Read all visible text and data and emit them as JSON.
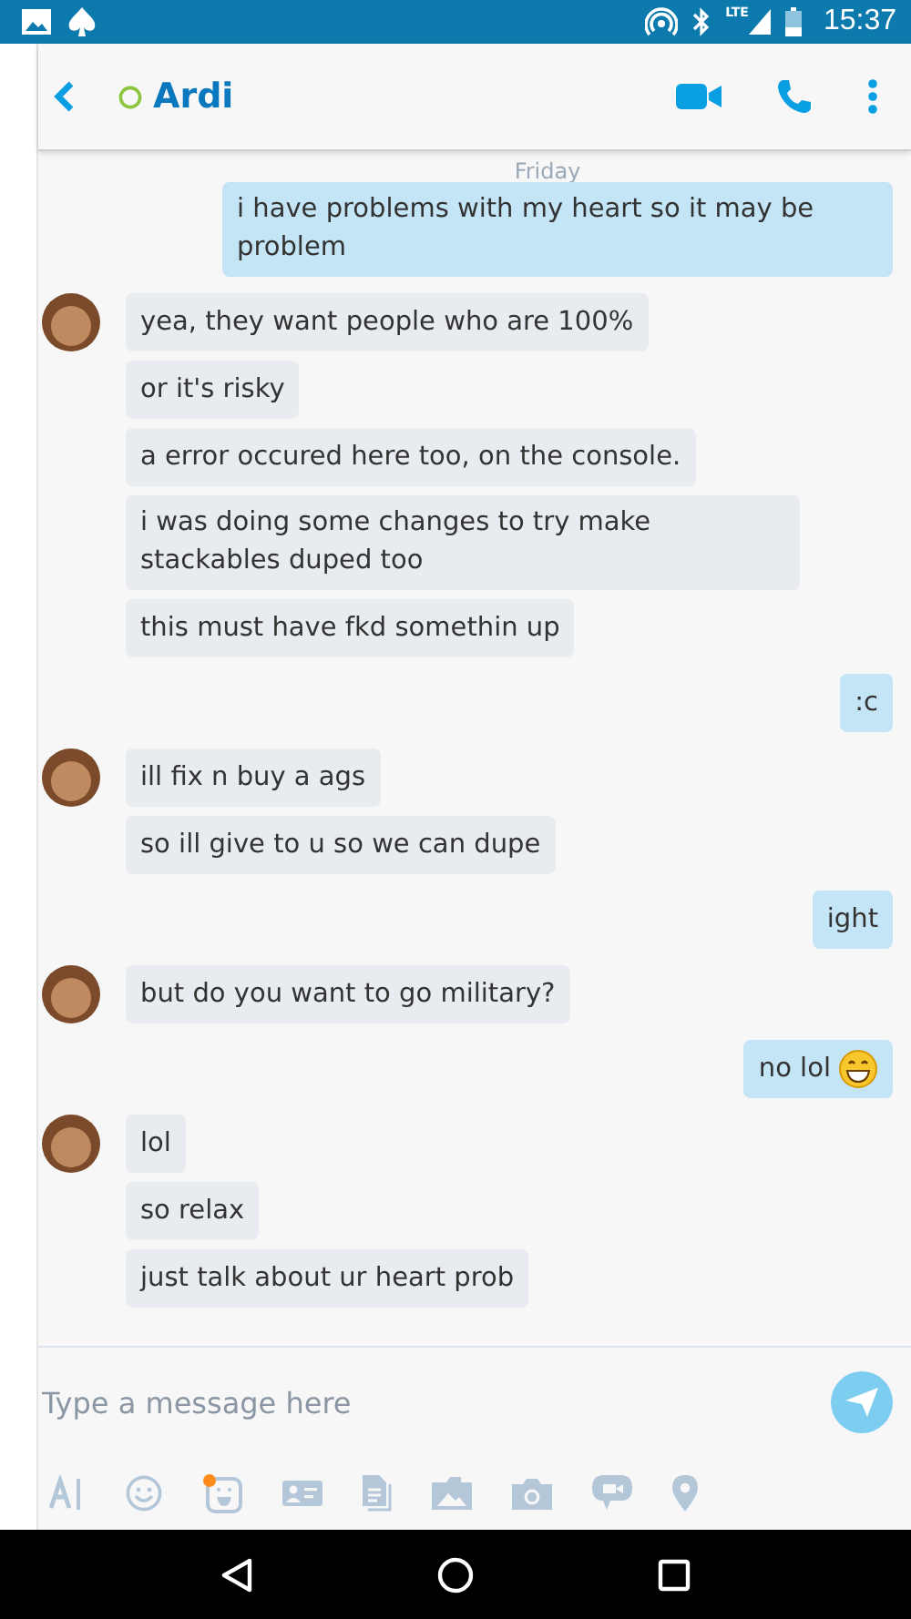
{
  "status_bar": {
    "network": "LTE",
    "time": "15:37"
  },
  "header": {
    "contact": "Ardi"
  },
  "day_label": "Friday",
  "groups": [
    {
      "kind": "outgoing",
      "messages": [
        {
          "text": "i have problems with my heart so it may be problem"
        }
      ]
    },
    {
      "kind": "incoming",
      "messages": [
        {
          "text": "yea, they want people who are 100%"
        },
        {
          "text": "or it's risky"
        },
        {
          "text": "a error occured here too, on the console."
        },
        {
          "text": "i was doing some changes to try make stackables duped too"
        },
        {
          "text": "this must have fkd somethin up"
        }
      ]
    },
    {
      "kind": "outgoing",
      "messages": [
        {
          "text": ":c"
        }
      ]
    },
    {
      "kind": "incoming",
      "messages": [
        {
          "text": "ill fix n buy a ags"
        },
        {
          "text": "so ill give to u so we can dupe"
        }
      ]
    },
    {
      "kind": "outgoing",
      "messages": [
        {
          "text": "ight"
        }
      ]
    },
    {
      "kind": "incoming",
      "messages": [
        {
          "text": "but do you want to go military?"
        }
      ]
    },
    {
      "kind": "outgoing",
      "messages": [
        {
          "text": "no lol",
          "emoticon": true
        }
      ]
    },
    {
      "kind": "incoming",
      "messages": [
        {
          "text": "lol"
        },
        {
          "text": "so relax"
        },
        {
          "text": "just talk about ur heart prob"
        }
      ]
    }
  ],
  "composer": {
    "placeholder": "Type a message here"
  }
}
